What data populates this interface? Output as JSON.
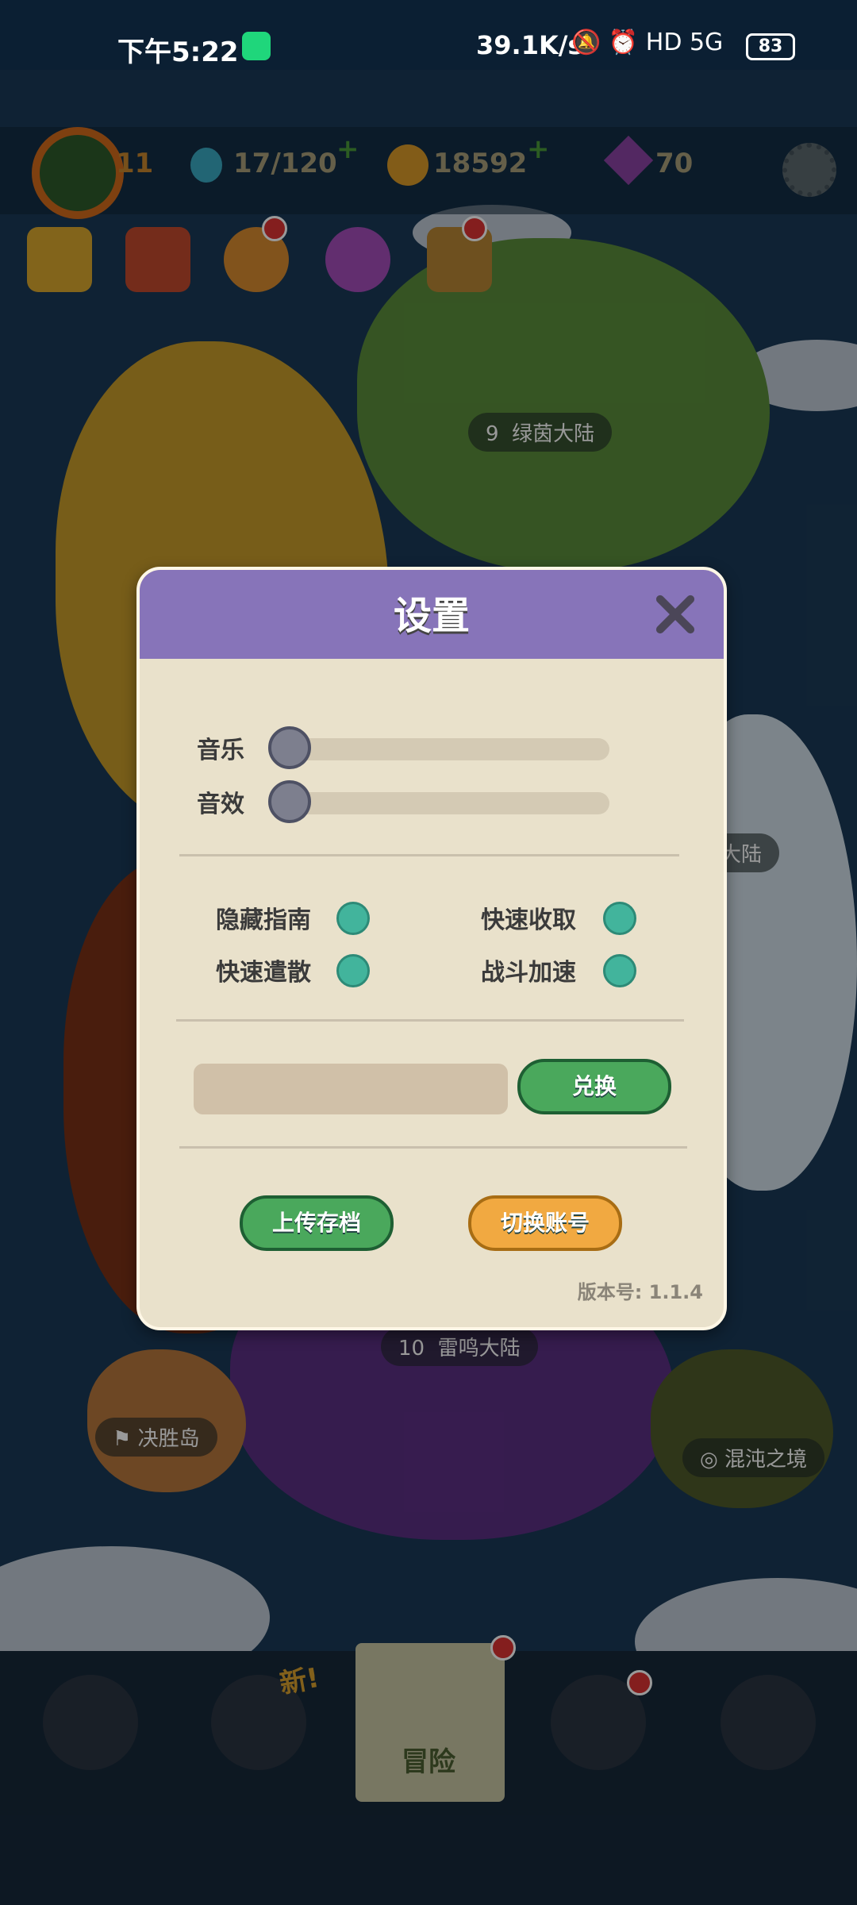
{
  "status_bar": {
    "time": "下午5:22",
    "speed": "39.1K/s",
    "icons": "🔕 ⏰ HD 5G",
    "battery": "83"
  },
  "hud": {
    "level": "11",
    "water": "17/120",
    "gold": "18592",
    "gems": "70"
  },
  "map_labels": {
    "island_9_num": "9",
    "island_9_name": "绿茵大陆",
    "island_10_num": "10",
    "island_10_name": "雷鸣大陆",
    "victory_island": "决胜岛",
    "chaos_realm": "混沌之境",
    "snow_partial": "大陆"
  },
  "bottom_nav": {
    "new_tag": "新!",
    "adventure_label": "冒险"
  },
  "settings": {
    "title": "设置",
    "music_label": "音乐",
    "sfx_label": "音效",
    "music_value": 0,
    "sfx_value": 0,
    "hide_guide": "隐藏指南",
    "quick_collect": "快速收取",
    "quick_dispatch": "快速遣散",
    "battle_speed": "战斗加速",
    "redeem_placeholder": "",
    "redeem_button": "兑换",
    "upload_button": "上传存档",
    "switch_button": "切换账号",
    "version": "版本号:  1.1.4"
  },
  "colors": {
    "header_purple": "#8774b9",
    "toggle_teal": "#42b49c",
    "button_green": "#4aa85c",
    "button_orange": "#f1a941"
  }
}
